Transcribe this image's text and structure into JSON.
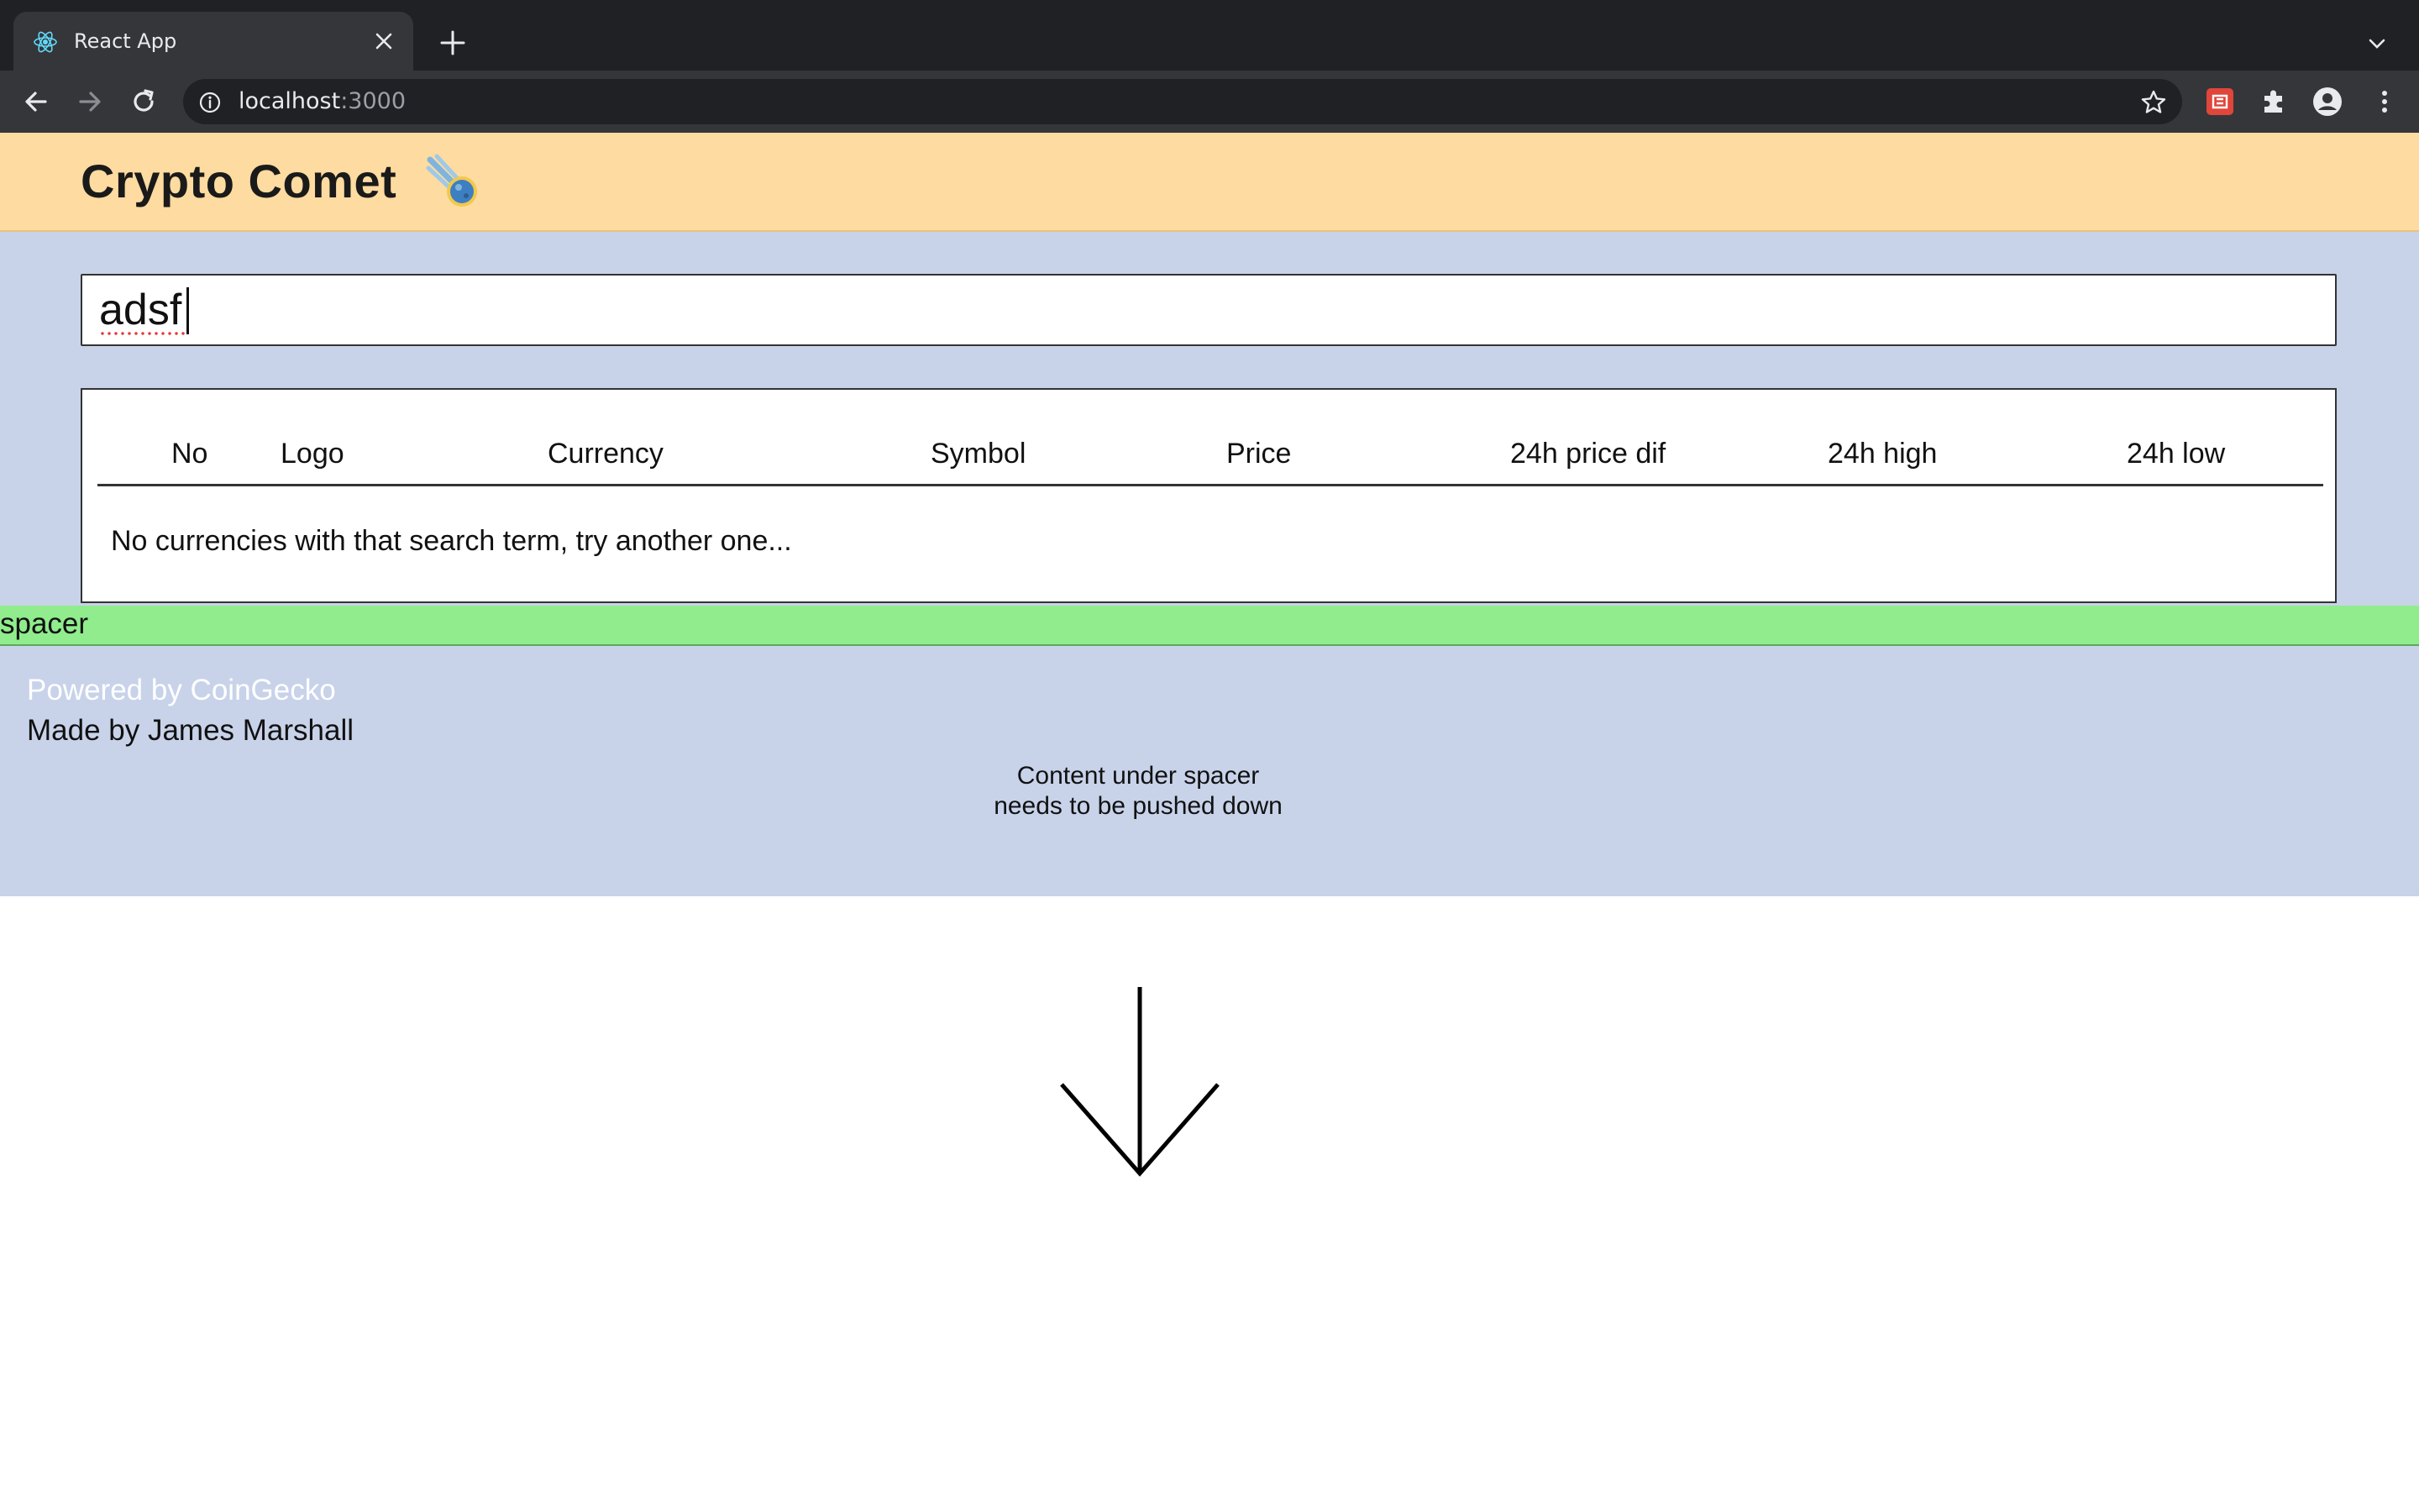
{
  "browser": {
    "tab_title": "React App",
    "url_host": "localhost",
    "url_port": ":3000"
  },
  "app": {
    "title": "Crypto Comet",
    "logo_icon": "comet-icon"
  },
  "search": {
    "value": "adsf",
    "placeholder": ""
  },
  "table": {
    "headers": [
      "No",
      "Logo",
      "Currency",
      "Symbol",
      "Price",
      "24h price dif",
      "24h high",
      "24h low"
    ],
    "empty_message": "No currencies with that search term, try another one..."
  },
  "spacer": {
    "label": "spacer"
  },
  "footer": {
    "powered_by": "Powered by CoinGecko",
    "made_by": "Made by James Marshall"
  },
  "annotation": {
    "note": "Content under spacer needs to be pushed down"
  },
  "colors": {
    "header_bg": "#fedba0",
    "main_bg": "#c8d3ea",
    "spacer_bg": "#90ec8c",
    "chrome_dark": "#202124",
    "chrome_toolbar": "#35363a"
  }
}
